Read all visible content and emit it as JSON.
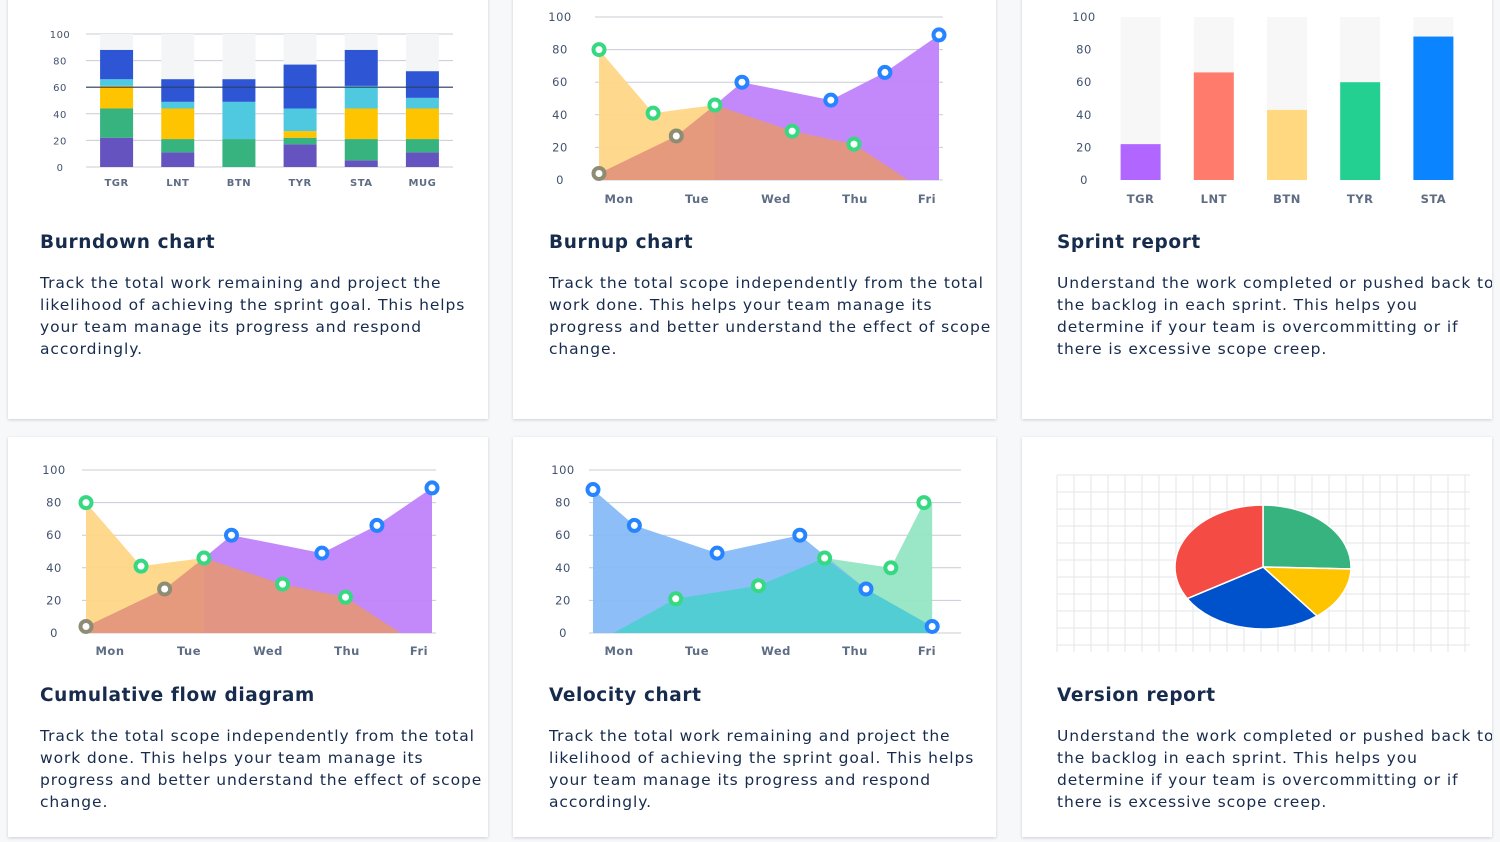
{
  "cards": [
    {
      "title": "Burndown chart",
      "description": "Track the total work remaining and project the likelihood of achieving the sprint goal. This helps your team manage its progress and respond accordingly.",
      "chart_data": {
        "type": "bar",
        "stacked": true,
        "categories": [
          "TGR",
          "LNT",
          "BTN",
          "TYR",
          "STA",
          "MUG"
        ],
        "yticks": [
          0,
          20,
          40,
          60,
          80,
          100
        ],
        "ylim": [
          0,
          100
        ],
        "series": [
          {
            "color": "#6554c0",
            "values": [
              22,
              11,
              0,
              17,
              5,
              11
            ]
          },
          {
            "color": "#36b37e",
            "values": [
              22,
              10,
              21,
              5,
              16,
              10
            ]
          },
          {
            "color": "#ffc400",
            "values": [
              17,
              23,
              0,
              5,
              23,
              23
            ]
          },
          {
            "color": "#4fc9e0",
            "values": [
              5,
              5,
              28,
              17,
              17,
              8
            ]
          },
          {
            "color": "#2d55d4",
            "values": [
              22,
              17,
              17,
              33,
              27,
              20
            ]
          }
        ]
      }
    },
    {
      "title": "Burnup chart",
      "description": "Track the total scope independently from the total work done. This helps your team manage its progress and better understand the effect of scope change.",
      "chart_data": {
        "type": "area",
        "x": [
          "Mon",
          "Tue",
          "Wed",
          "Thu",
          "Fri"
        ],
        "yticks": [
          0,
          20,
          40,
          60,
          80,
          100
        ],
        "ylim": [
          0,
          100
        ],
        "series": [
          {
            "fill": "#fed686",
            "points": [
              [
                0,
                80
              ],
              [
                0.7,
                41
              ],
              [
                1.5,
                46
              ],
              [
                2.5,
                30
              ],
              [
                3.3,
                22
              ],
              [
                4,
                0
              ]
            ]
          },
          {
            "fill": "#c083fb",
            "points": [
              [
                1.5,
                46
              ],
              [
                1.85,
                60
              ],
              [
                3,
                49
              ],
              [
                3.7,
                66
              ],
              [
                4.4,
                89
              ]
            ]
          },
          {
            "fill": "#e4967c",
            "points": [
              [
                0,
                4
              ],
              [
                1,
                27
              ],
              [
                1.5,
                46
              ],
              [
                2.5,
                30
              ],
              [
                3.3,
                22
              ],
              [
                4,
                0
              ]
            ]
          }
        ],
        "markers": [
          {
            "x": 0,
            "y": 80,
            "color": "#36d982"
          },
          {
            "x": 0.7,
            "y": 41,
            "color": "#36d982"
          },
          {
            "x": 1.5,
            "y": 46,
            "color": "#36d982"
          },
          {
            "x": 2.5,
            "y": 30,
            "color": "#36d982"
          },
          {
            "x": 3.3,
            "y": 22,
            "color": "#36d982"
          },
          {
            "x": 1.85,
            "y": 60,
            "color": "#2684ff"
          },
          {
            "x": 3,
            "y": 49,
            "color": "#2684ff"
          },
          {
            "x": 3.7,
            "y": 66,
            "color": "#2684ff"
          },
          {
            "x": 4.4,
            "y": 89,
            "color": "#2684ff"
          },
          {
            "x": 0,
            "y": 4,
            "color": "#8e8d74"
          },
          {
            "x": 1,
            "y": 27,
            "color": "#8e8d74"
          }
        ]
      }
    },
    {
      "title": "Sprint report",
      "description": "Understand the work completed or pushed back to the backlog in each sprint. This helps you determine if your team is overcommitting or if there is excessive scope creep.",
      "chart_data": {
        "type": "bar",
        "categories": [
          "TGR",
          "LNT",
          "BTN",
          "TYR",
          "STA"
        ],
        "yticks": [
          0,
          20,
          40,
          60,
          80,
          100
        ],
        "ylim": [
          0,
          100
        ],
        "values": [
          22,
          66,
          43,
          60,
          88
        ],
        "colors": [
          "#b066ff",
          "#ff7b6b",
          "#ffd880",
          "#23d092",
          "#0b84ff"
        ]
      }
    },
    {
      "title": "Cumulative flow diagram",
      "description": "Track the total scope independently from the total work done. This helps your team manage its progress and better understand the effect of scope change.",
      "chart_data": {
        "type": "area",
        "x": [
          "Mon",
          "Tue",
          "Wed",
          "Thu",
          "Fri"
        ],
        "yticks": [
          0,
          20,
          40,
          60,
          80,
          100
        ],
        "ylim": [
          0,
          100
        ],
        "series": [
          {
            "fill": "#fed686",
            "points": [
              [
                0,
                80
              ],
              [
                0.7,
                41
              ],
              [
                1.5,
                46
              ],
              [
                2.5,
                30
              ],
              [
                3.3,
                22
              ],
              [
                4,
                0
              ]
            ]
          },
          {
            "fill": "#c083fb",
            "points": [
              [
                1.5,
                46
              ],
              [
                1.85,
                60
              ],
              [
                3,
                49
              ],
              [
                3.7,
                66
              ],
              [
                4.4,
                89
              ]
            ]
          },
          {
            "fill": "#e4967c",
            "points": [
              [
                0,
                4
              ],
              [
                1,
                27
              ],
              [
                1.5,
                46
              ],
              [
                2.5,
                30
              ],
              [
                3.3,
                22
              ],
              [
                4,
                0
              ]
            ]
          }
        ],
        "markers": [
          {
            "x": 0,
            "y": 80,
            "color": "#36d982"
          },
          {
            "x": 0.7,
            "y": 41,
            "color": "#36d982"
          },
          {
            "x": 1.5,
            "y": 46,
            "color": "#36d982"
          },
          {
            "x": 2.5,
            "y": 30,
            "color": "#36d982"
          },
          {
            "x": 3.3,
            "y": 22,
            "color": "#36d982"
          },
          {
            "x": 1.85,
            "y": 60,
            "color": "#2684ff"
          },
          {
            "x": 3,
            "y": 49,
            "color": "#2684ff"
          },
          {
            "x": 3.7,
            "y": 66,
            "color": "#2684ff"
          },
          {
            "x": 4.4,
            "y": 89,
            "color": "#2684ff"
          },
          {
            "x": 0,
            "y": 4,
            "color": "#8e8d74"
          },
          {
            "x": 1,
            "y": 27,
            "color": "#8e8d74"
          }
        ]
      }
    },
    {
      "title": "Velocity chart",
      "description": "Track the total work remaining and project the likelihood of achieving the sprint goal. This helps your team manage its progress and respond accordingly.",
      "chart_data": {
        "type": "area",
        "x": [
          "Mon",
          "Tue",
          "Wed",
          "Thu",
          "Fri"
        ],
        "yticks": [
          0,
          20,
          40,
          60,
          80,
          100
        ],
        "ylim": [
          0,
          100
        ],
        "series": [
          {
            "fill": "#94e6c4",
            "points": [
              [
                0.25,
                0
              ],
              [
                1,
                21
              ],
              [
                2,
                29
              ],
              [
                2.8,
                46
              ],
              [
                3.6,
                40
              ],
              [
                4,
                80
              ],
              [
                4.1,
                80
              ],
              [
                4.1,
                4
              ]
            ]
          },
          {
            "fill": "#87bbf7",
            "points": [
              [
                0,
                88
              ],
              [
                0.5,
                66
              ],
              [
                1.5,
                49
              ],
              [
                2.5,
                60
              ],
              [
                3.3,
                27
              ],
              [
                4.1,
                4
              ]
            ]
          },
          {
            "fill": "#4fcdd1",
            "points": [
              [
                0.25,
                0
              ],
              [
                1,
                21
              ],
              [
                2,
                29
              ],
              [
                2.8,
                46
              ],
              [
                3.3,
                27
              ],
              [
                4.1,
                4
              ],
              [
                4.1,
                0
              ]
            ]
          }
        ],
        "markers": [
          {
            "x": 0,
            "y": 88,
            "color": "#2684ff"
          },
          {
            "x": 0.5,
            "y": 66,
            "color": "#2684ff"
          },
          {
            "x": 1.5,
            "y": 49,
            "color": "#2684ff"
          },
          {
            "x": 2.5,
            "y": 60,
            "color": "#2684ff"
          },
          {
            "x": 3.3,
            "y": 27,
            "color": "#2684ff"
          },
          {
            "x": 4.1,
            "y": 4,
            "color": "#2684ff"
          },
          {
            "x": 1,
            "y": 21,
            "color": "#36d982"
          },
          {
            "x": 2,
            "y": 29,
            "color": "#36d982"
          },
          {
            "x": 2.8,
            "y": 46,
            "color": "#36d982"
          },
          {
            "x": 3.6,
            "y": 40,
            "color": "#36d982"
          },
          {
            "x": 4,
            "y": 80,
            "color": "#36d982"
          }
        ]
      }
    },
    {
      "title": "Version report",
      "description": "Understand the work completed or pushed back to the backlog in each sprint. This helps you determine if your team is overcommitting or if there is excessive scope creep.",
      "chart_data": {
        "type": "pie",
        "slices": [
          {
            "value": 25.5,
            "color": "#36b37e"
          },
          {
            "value": 14,
            "color": "#ffc400"
          },
          {
            "value": 27,
            "color": "#0052cc"
          },
          {
            "value": 33.5,
            "color": "#f44c44"
          }
        ]
      }
    }
  ]
}
